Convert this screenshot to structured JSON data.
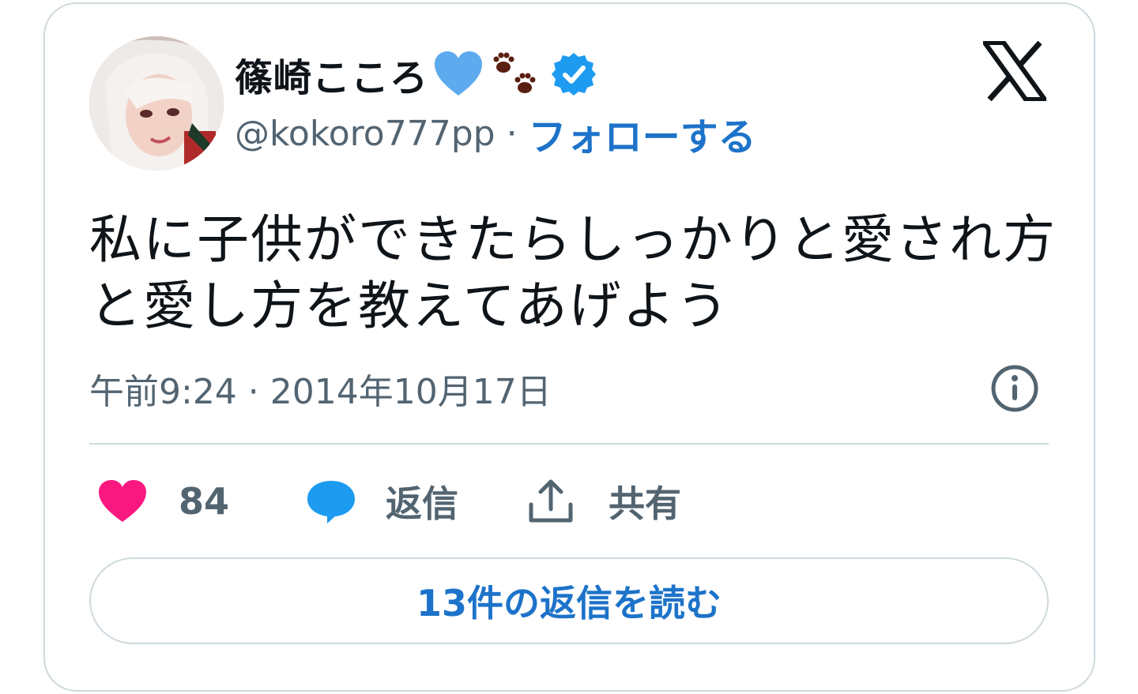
{
  "card": {
    "user": {
      "display_name": "篠崎こころ",
      "handle": "@kokoro777pp",
      "separator": "·",
      "follow_label": "フォローする",
      "emojis": [
        "blue-heart-icon",
        "paw-prints-icon"
      ],
      "verified_icon": "verified-badge-icon",
      "avatar_icon": "avatar-photo"
    },
    "brand_icon": "x-logo-icon",
    "tweet_text": "私に子供ができたらしっかりと愛され方と愛し方を教えてあげよう",
    "timestamp": "午前9:24 · 2014年10月17日",
    "info_icon": "info-icon",
    "actions": {
      "like": {
        "icon": "heart-icon",
        "label": "84"
      },
      "reply": {
        "icon": "speech-bubble-icon",
        "label": "返信"
      },
      "share": {
        "icon": "upload-share-icon",
        "label": "共有"
      }
    },
    "read_replies_label": "13件の返信を読む",
    "colors": {
      "link_blue": "#1d73c9",
      "heart_pink": "#f91880",
      "reply_blue": "#1d9bf0",
      "secondary_text": "#536471",
      "border": "#cfd9de"
    }
  }
}
